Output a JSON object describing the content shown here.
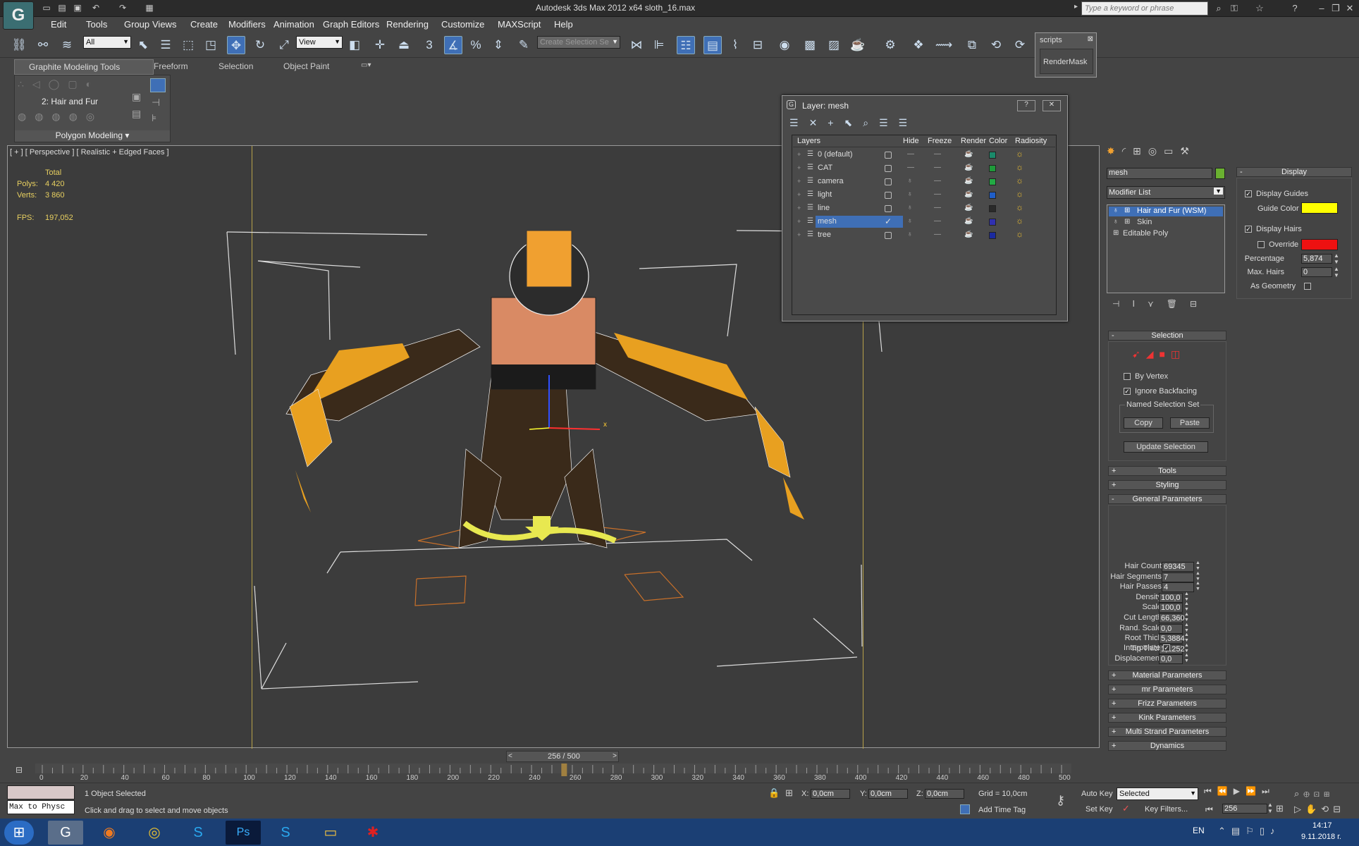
{
  "window": {
    "title": "Autodesk 3ds Max  2012 x64      sloth_16.max",
    "search_placeholder": "Type a keyword or phrase"
  },
  "menu": [
    "Edit",
    "Tools",
    "Group",
    "Views",
    "Create",
    "Modifiers",
    "Animation",
    "Graph Editors",
    "Rendering",
    "Customize",
    "MAXScript",
    "Help"
  ],
  "toolbar": {
    "filter_value": "All",
    "refcoord_value": "View",
    "named_selection_placeholder": "Create Selection Se"
  },
  "scripts_panel": {
    "title": "scripts",
    "button": "RenderMask"
  },
  "ribbon": {
    "tabs": [
      "Graphite Modeling Tools",
      "Freeform",
      "Selection",
      "Object Paint"
    ],
    "level_label": "2: Hair and Fur",
    "panel_label": "Polygon Modeling"
  },
  "viewport": {
    "label": "[ + ] [ Perspective ] [ Realistic + Edged Faces ]",
    "stats": {
      "total": "Total",
      "polys_label": "Polys:",
      "polys": "4 420",
      "verts_label": "Verts:",
      "verts": "3 860",
      "fps_label": "FPS:",
      "fps": "197,052"
    },
    "axis_x": "x"
  },
  "layer_dialog": {
    "title": "Layer: mesh",
    "columns": [
      "Layers",
      "Hide",
      "Freeze",
      "Render",
      "Color",
      "Radiosity"
    ],
    "rows": [
      {
        "name": "0 (default)",
        "color": "#1a8a6a"
      },
      {
        "name": "CAT",
        "color": "#1f9a3a"
      },
      {
        "name": "camera",
        "color": "#22aa44"
      },
      {
        "name": "light",
        "color": "#1f5ec8"
      },
      {
        "name": "line",
        "color": "#2a2a2a"
      },
      {
        "name": "mesh",
        "color": "#3030b0",
        "active": true
      },
      {
        "name": "tree",
        "color": "#1a2aa0"
      }
    ],
    "active_check": "✓"
  },
  "command_panel": {
    "object_name": "mesh",
    "object_color": "#6ab030",
    "modifier_list": "Modifier List",
    "stack": [
      "Hair and Fur (WSM)",
      "Skin",
      "Editable Poly"
    ],
    "selection": {
      "title": "Selection",
      "by_vertex": "By Vertex",
      "ignore_backfacing": "Ignore Backfacing",
      "named_set": "Named Selection Set",
      "copy": "Copy",
      "paste": "Paste",
      "update": "Update Selection"
    },
    "rollups_closed_top": [
      "Tools",
      "Styling"
    ],
    "general": {
      "title": "General Parameters",
      "params": [
        {
          "label": "Hair Count",
          "value": "69345"
        },
        {
          "label": "Hair Segments",
          "value": "7"
        },
        {
          "label": "Hair Passes",
          "value": "4"
        },
        {
          "label": "Density",
          "value": "100,0"
        },
        {
          "label": "Scale",
          "value": "100,0"
        },
        {
          "label": "Cut Length",
          "value": "66,360"
        },
        {
          "label": "Rand. Scale",
          "value": "0,0"
        },
        {
          "label": "Root Thick",
          "value": "5,3884"
        },
        {
          "label": "Tip Thick",
          "value": "1,1252"
        },
        {
          "label": "Displacement",
          "value": "0,0"
        }
      ],
      "interpolate": "Interpolate"
    },
    "rollups_closed_bottom": [
      "Material Parameters",
      "mr Parameters",
      "Frizz Parameters",
      "Kink Parameters",
      "Multi Strand Parameters",
      "Dynamics"
    ]
  },
  "display_panel": {
    "title": "Display",
    "display_guides": "Display Guides",
    "guide_color_label": "Guide Color",
    "guide_color": "#ffff00",
    "display_hairs": "Display Hairs",
    "override": "Override",
    "override_color": "#ee1111",
    "percentage_label": "Percentage",
    "percentage": "5,874",
    "max_hairs_label": "Max. Hairs",
    "max_hairs": "0",
    "as_geometry": "As Geometry"
  },
  "timeline": {
    "frame_display": "256 / 500",
    "current_frame": 256,
    "max_frame": 500,
    "ticks": [
      "0",
      "20",
      "40",
      "60",
      "80",
      "100",
      "120",
      "140",
      "160",
      "180",
      "200",
      "220",
      "240",
      "260",
      "280",
      "300",
      "320",
      "340",
      "360",
      "380",
      "400",
      "420",
      "440",
      "460",
      "480",
      "500"
    ]
  },
  "status": {
    "script_text": "Max to Physc",
    "selected": "1 Object Selected",
    "prompt": "Click and drag to select and move objects",
    "x_label": "X:",
    "x": "0,0cm",
    "y_label": "Y:",
    "y": "0,0cm",
    "z_label": "Z:",
    "z": "0,0cm",
    "grid": "Grid = 10,0cm",
    "add_time_tag": "Add Time Tag",
    "auto_key": "Auto Key",
    "set_key": "Set Key",
    "key_mode": "Selected",
    "key_filters": "Key Filters...",
    "frame": "256"
  },
  "taskbar": {
    "lang": "EN",
    "time": "14:17",
    "date": "9.11.2018 г."
  }
}
